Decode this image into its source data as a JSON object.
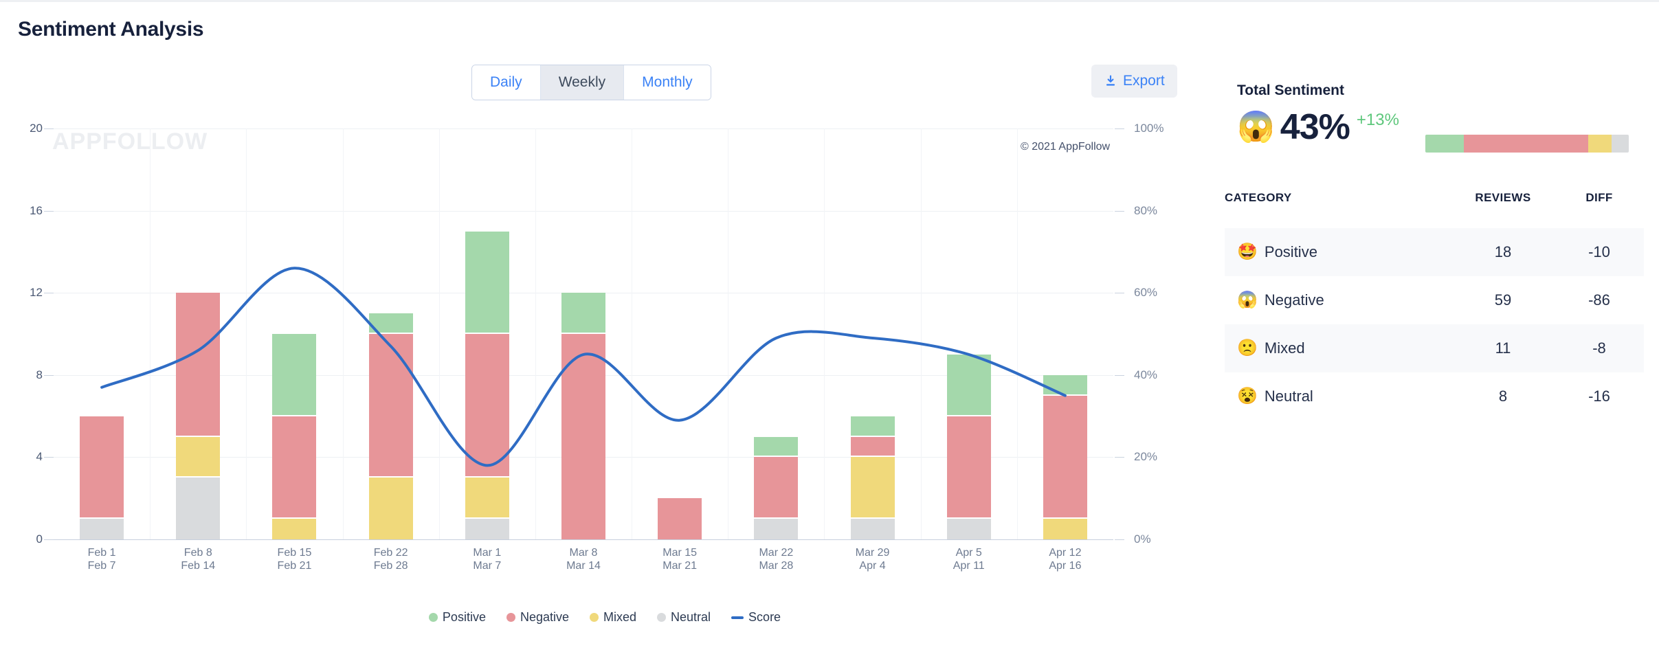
{
  "header": {
    "title": "Sentiment Analysis",
    "tabs": [
      {
        "label": "Daily",
        "active": false
      },
      {
        "label": "Weekly",
        "active": true
      },
      {
        "label": "Monthly",
        "active": false
      }
    ],
    "export_label": "Export",
    "export_icon": "download-icon"
  },
  "chart": {
    "watermark": "APPFOLLOW",
    "copyright": "© 2021 AppFollow",
    "legend": [
      {
        "label": "Positive",
        "color": "#a4d8ab",
        "marker": "dot"
      },
      {
        "label": "Negative",
        "color": "#e79599",
        "marker": "dot"
      },
      {
        "label": "Mixed",
        "color": "#f0d97b",
        "marker": "dot"
      },
      {
        "label": "Neutral",
        "color": "#d9dbdd",
        "marker": "dot"
      },
      {
        "label": "Score",
        "color": "#2f6cc4",
        "marker": "line"
      }
    ]
  },
  "chart_data": {
    "type": "bar",
    "title": "Sentiment Analysis",
    "subtype": "stacked-bar-with-line",
    "xlabel": "",
    "ylabel": "",
    "categories": [
      "Feb 1\nFeb 7",
      "Feb 8\nFeb 14",
      "Feb 15\nFeb 21",
      "Feb 22\nFeb 28",
      "Mar 1\nMar 7",
      "Mar 8\nMar 14",
      "Mar 15\nMar 21",
      "Mar 22\nMar 28",
      "Mar 29\nApr 4",
      "Apr 5\nApr 11",
      "Apr 12\nApr 16"
    ],
    "category_lines": [
      [
        "Feb 1",
        "Feb 7"
      ],
      [
        "Feb 8",
        "Feb 14"
      ],
      [
        "Feb 15",
        "Feb 21"
      ],
      [
        "Feb 22",
        "Feb 28"
      ],
      [
        "Mar 1",
        "Mar 7"
      ],
      [
        "Mar 8",
        "Mar 14"
      ],
      [
        "Mar 15",
        "Mar 21"
      ],
      [
        "Mar 22",
        "Mar 28"
      ],
      [
        "Mar 29",
        "Apr 4"
      ],
      [
        "Apr 5",
        "Apr 11"
      ],
      [
        "Apr 12",
        "Apr 16"
      ]
    ],
    "series": [
      {
        "name": "Neutral",
        "color": "#d9dbdd",
        "values": [
          1,
          3,
          0,
          0,
          1,
          0,
          0,
          1,
          1,
          1,
          0
        ]
      },
      {
        "name": "Mixed",
        "color": "#f0d97b",
        "values": [
          0,
          2,
          1,
          3,
          2,
          0,
          0,
          0,
          3,
          0,
          1
        ]
      },
      {
        "name": "Negative",
        "color": "#e79599",
        "values": [
          5,
          7,
          5,
          7,
          7,
          10,
          2,
          3,
          1,
          5,
          6
        ]
      },
      {
        "name": "Positive",
        "color": "#a4d8ab",
        "values": [
          0,
          0,
          4,
          1,
          5,
          2,
          0,
          1,
          1,
          3,
          1
        ]
      }
    ],
    "totals": [
      6,
      12,
      10,
      11,
      15,
      12,
      2,
      5,
      6,
      9,
      8
    ],
    "line_series": {
      "name": "Score",
      "color": "#2f6cc4",
      "axis": "right",
      "unit": "%",
      "values": [
        37,
        46,
        66,
        47,
        18,
        45,
        29,
        49,
        49,
        45,
        35
      ]
    },
    "yaxis_left": {
      "ticks": [
        0,
        4,
        8,
        12,
        16,
        20
      ],
      "min": 0,
      "max": 20
    },
    "yaxis_right": {
      "ticks": [
        "0%",
        "20%",
        "40%",
        "60%",
        "80%",
        "100%"
      ],
      "min": 0,
      "max": 100
    },
    "grid": true,
    "legend_position": "bottom"
  },
  "sidebar": {
    "total_sentiment_label": "Total Sentiment",
    "summary": {
      "emoji": "😱",
      "emoji_name": "face-screaming-in-fear-icon",
      "value": "43%",
      "delta": "+13%",
      "delta_color": "#5ec77c"
    },
    "distribution_bar": [
      {
        "name": "Positive",
        "color": "#a4d8ab",
        "pct": 18.75
      },
      {
        "name": "Negative",
        "color": "#e79599",
        "pct": 61.46
      },
      {
        "name": "Mixed",
        "color": "#f0d97b",
        "pct": 11.46
      },
      {
        "name": "Neutral",
        "color": "#d9dbdd",
        "pct": 8.33
      }
    ],
    "table": {
      "headers": [
        "CATEGORY",
        "REVIEWS",
        "DIFF"
      ],
      "rows": [
        {
          "emoji": "🤩",
          "emoji_name": "star-struck-icon",
          "category": "Positive",
          "reviews": "18",
          "diff": "-10",
          "diff_sign": "neg"
        },
        {
          "emoji": "😱",
          "emoji_name": "face-screaming-in-fear-icon",
          "category": "Negative",
          "reviews": "59",
          "diff": "-86",
          "diff_sign": "pos"
        },
        {
          "emoji": "🙁",
          "emoji_name": "slightly-frowning-face-icon",
          "category": "Mixed",
          "reviews": "11",
          "diff": "-8",
          "diff_sign": "neg"
        },
        {
          "emoji": "😵",
          "emoji_name": "dizzy-face-icon",
          "category": "Neutral",
          "reviews": "8",
          "diff": "-16",
          "diff_sign": "neg"
        }
      ]
    }
  }
}
